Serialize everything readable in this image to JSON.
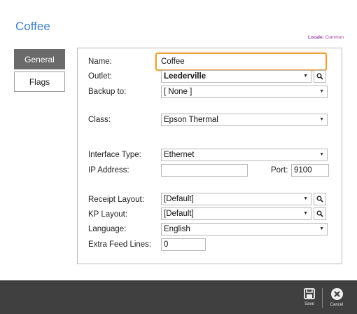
{
  "page": {
    "title": "Coffee"
  },
  "locale": {
    "label": "Locale:",
    "value": "Common"
  },
  "tabs": [
    {
      "label": "General",
      "active": true
    },
    {
      "label": "Flags",
      "active": false
    }
  ],
  "form": {
    "name": {
      "label": "Name:",
      "value": "Coffee"
    },
    "outlet": {
      "label": "Outlet:",
      "value": "Leederville"
    },
    "backup": {
      "label": "Backup to:",
      "value": "[ None ]"
    },
    "class": {
      "label": "Class:",
      "value": "Epson Thermal"
    },
    "interface_type": {
      "label": "Interface Type:",
      "value": "Ethernet"
    },
    "ip_address": {
      "label": "IP Address:",
      "value": ""
    },
    "port": {
      "label": "Port:",
      "value": "9100"
    },
    "receipt_layout": {
      "label": "Receipt Layout:",
      "value": "[Default]"
    },
    "kp_layout": {
      "label": "KP Layout:",
      "value": "[Default]"
    },
    "language": {
      "label": "Language:",
      "value": "English"
    },
    "extra_feed_lines": {
      "label": "Extra Feed Lines:",
      "value": "0"
    }
  },
  "toolbar": {
    "save_label": "Save",
    "cancel_label": "Cancel"
  },
  "icons": {
    "dropdown": "chevron-down-icon",
    "search": "magnifier-icon",
    "save": "floppy-disk-icon",
    "cancel": "close-circle-icon"
  },
  "colors": {
    "title": "#3f7fc8",
    "locale": "#9b2fa0",
    "focus_border": "#e9a23b",
    "active_tab": "#6a6a6a",
    "bottom_bar": "#404040"
  }
}
